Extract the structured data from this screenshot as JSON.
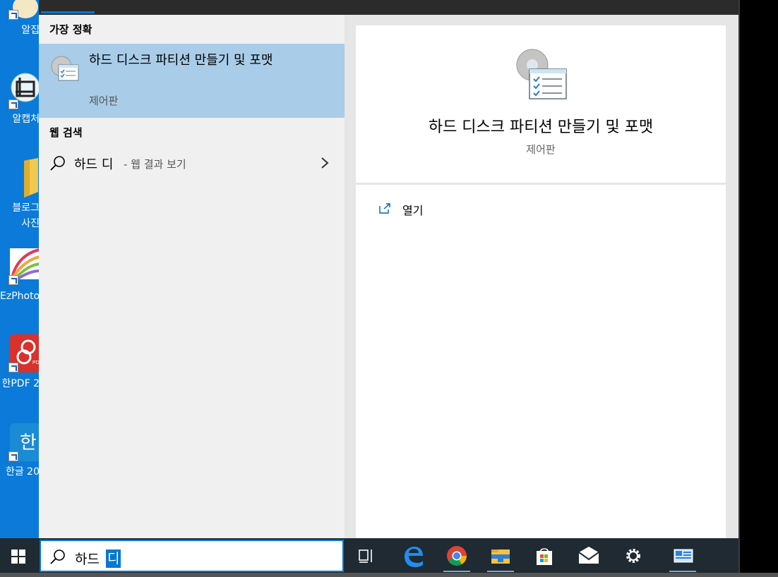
{
  "desktop": {
    "icons": [
      {
        "label": "알집"
      },
      {
        "label": "알캡처"
      },
      {
        "label": "블로그",
        "label2": "사진"
      },
      {
        "label": "EzPhoto"
      },
      {
        "label": "한PDF 2"
      },
      {
        "label": "한글 20"
      }
    ]
  },
  "start_menu": {
    "best_match_header": "가장 정확",
    "best_match": {
      "title": "하드 디스크 파티션 만들기 및 포맷",
      "subtitle": "제어판",
      "icon": "control-panel-icon"
    },
    "web_search_header": "웹 검색",
    "web_search": {
      "query": "하드 디",
      "suffix": "- 웹 결과 보기"
    },
    "detail": {
      "title": "하드 디스크 파티션 만들기 및 포맷",
      "subtitle": "제어판"
    },
    "actions": [
      {
        "label": "열기",
        "icon": "open-external-icon"
      }
    ]
  },
  "taskbar": {
    "search_typed": "하드 ",
    "search_selected": "디",
    "apps": [
      {
        "name": "task-view-icon"
      },
      {
        "name": "edge-icon"
      },
      {
        "name": "chrome-icon"
      },
      {
        "name": "file-explorer-icon"
      },
      {
        "name": "store-icon"
      },
      {
        "name": "mail-icon"
      },
      {
        "name": "settings-icon"
      },
      {
        "name": "control-panel-icon"
      }
    ]
  },
  "colors": {
    "accent": "#0078d7",
    "selection": "#a9cce8",
    "desktop": "#0b7ad8",
    "taskbar": "#1f2a33"
  }
}
